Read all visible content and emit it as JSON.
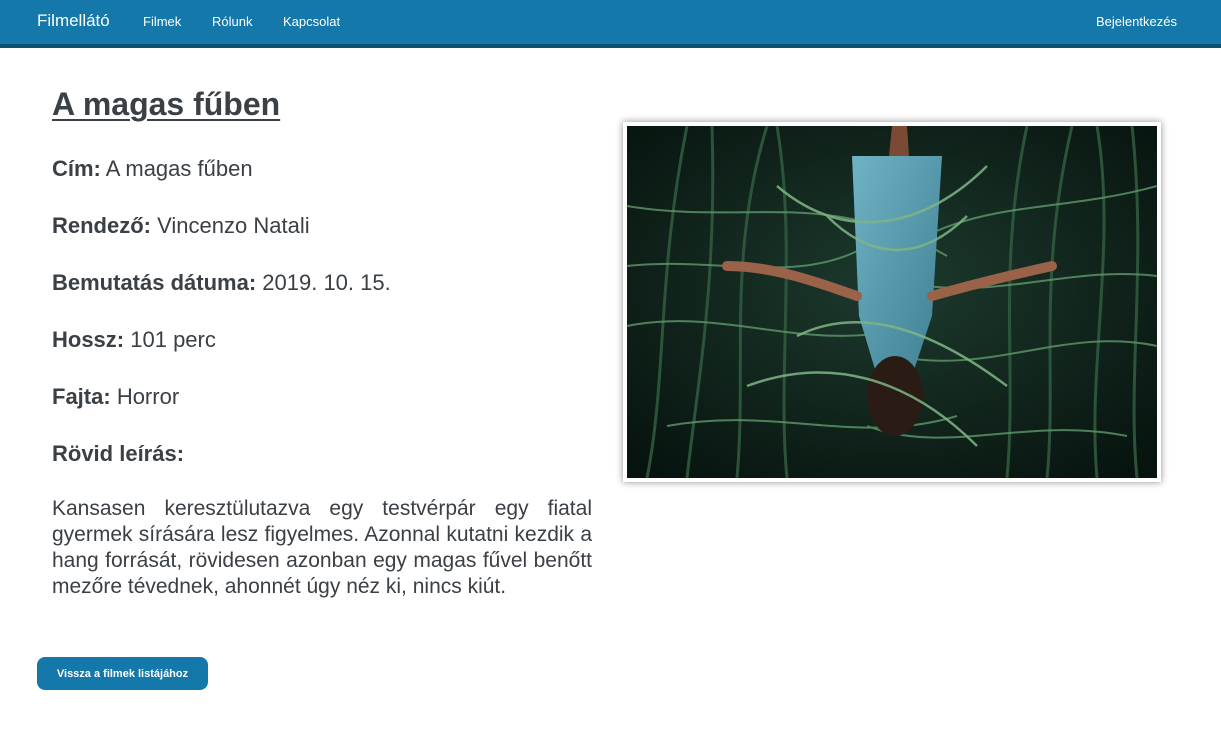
{
  "navbar": {
    "brand": "Filmellátó",
    "links": [
      "Filmek",
      "Rólunk",
      "Kapcsolat"
    ],
    "login": "Bejelentkezés"
  },
  "movie": {
    "heading": "A magas fűben",
    "fields": [
      {
        "label": "Cím:",
        "value": "A magas fűben"
      },
      {
        "label": "Rendező:",
        "value": "Vincenzo Natali"
      },
      {
        "label": "Bemutatás dátuma:",
        "value": "2019. 10. 15."
      },
      {
        "label": "Hossz:",
        "value": "101 perc"
      },
      {
        "label": "Fajta:",
        "value": "Horror"
      }
    ],
    "description_label": "Rövid leírás:",
    "description": "Kansasen keresztülutazva egy testvérpár egy fiatal gyermek sírására lesz figyelmes. Azonnal kutatni kezdik a hang forrását, rövidesen azonban egy magas fűvel benőtt mezőre tévednek, ahonnét úgy néz ki, nincs kiút."
  },
  "actions": {
    "back_label": "Vissza a filmek listájához"
  },
  "colors": {
    "navbar": "#1478aa",
    "navbar_border": "#0b5173",
    "button": "#1478aa",
    "text": "#3a4045"
  }
}
